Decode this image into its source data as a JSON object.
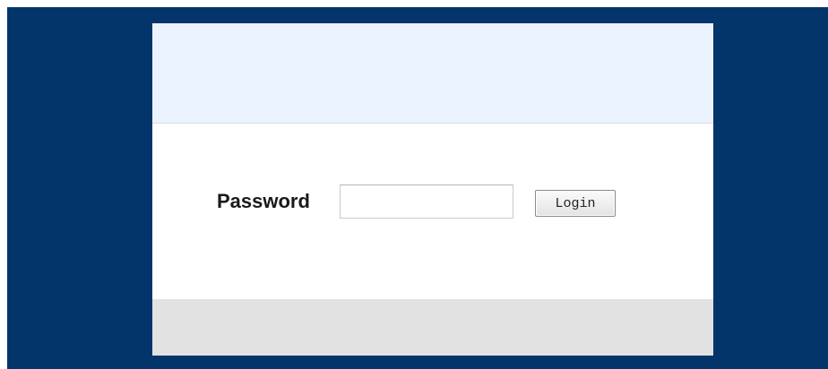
{
  "login_form": {
    "password_label": "Password",
    "password_value": "",
    "login_button_label": "Login"
  },
  "colors": {
    "background": "#03356b",
    "header_band": "#ebf3fe",
    "footer_band": "#e2e2e2",
    "panel": "#ffffff"
  }
}
